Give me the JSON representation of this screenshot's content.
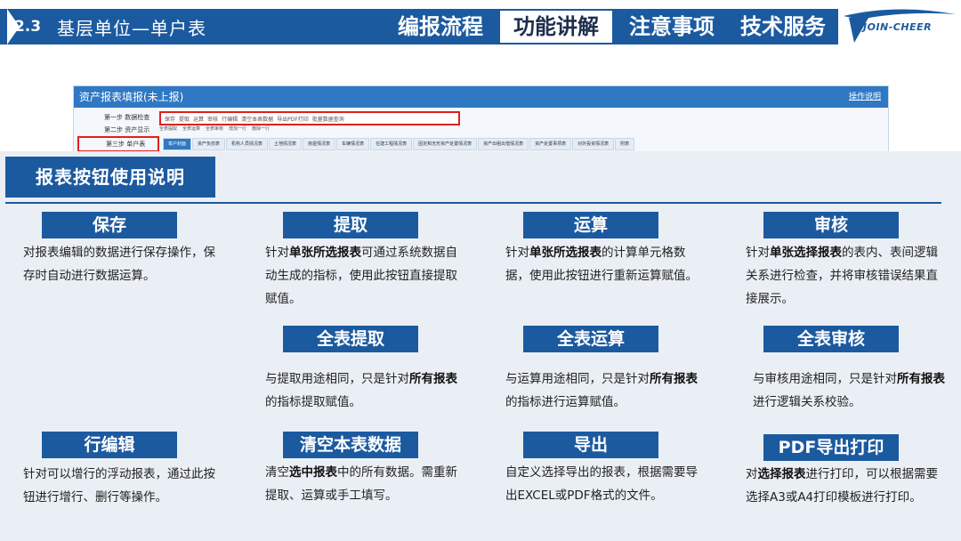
{
  "header": {
    "section_number": "2.3",
    "section_title": "基层单位—单户表",
    "tabs": [
      {
        "label": "编报流程",
        "active": false
      },
      {
        "label": "功能讲解",
        "active": true
      },
      {
        "label": "注意事项",
        "active": false
      },
      {
        "label": "技术服务",
        "active": false
      }
    ],
    "logo_text": "JOIN-CHEER"
  },
  "screenshot": {
    "title": "资产报表填报(未上报)",
    "help_link": "操作说明",
    "steps": [
      "第一步 数据检查",
      "第二步 资产显示",
      "第三步 单户表"
    ],
    "toolbar": [
      "保存",
      "提取",
      "运算",
      "审核",
      "行编辑",
      "清空本表数据",
      "导出PDF打印",
      "批量数据查询"
    ],
    "toolbar_sub": [
      "全表提取",
      "全表运算",
      "全表审核",
      "增加一行",
      "删除一行"
    ],
    "sheet_tabs": [
      "单户封面",
      "资产负债表",
      "机构人员情况表",
      "土地情况表",
      "房屋情况表",
      "车辆情况表",
      "在建工程情况表",
      "固定和无形资产处置情况表",
      "资产出租出借情况表",
      "资产处置事项表",
      "对外投资情况表",
      "附表"
    ]
  },
  "panel": {
    "title": "报表按钮使用说明",
    "items": [
      {
        "label": "保存",
        "desc": [
          {
            "t": "对报表编辑的数据进行保存操作，保存时自动进行数据运算。",
            "b": false
          }
        ]
      },
      {
        "label": "提取",
        "desc": [
          {
            "t": "针对",
            "b": false
          },
          {
            "t": "单张所选报表",
            "b": true
          },
          {
            "t": "可通过系统数据自动生成的指标，使用此按钮直接提取赋值。",
            "b": false
          }
        ]
      },
      {
        "label": "运算",
        "desc": [
          {
            "t": "针对",
            "b": false
          },
          {
            "t": "单张所选报表",
            "b": true
          },
          {
            "t": "的计算单元格数据，使用此按钮进行重新运算赋值。",
            "b": false
          }
        ]
      },
      {
        "label": "审核",
        "desc": [
          {
            "t": "针对",
            "b": false
          },
          {
            "t": "单张选择报表",
            "b": true
          },
          {
            "t": "的表内、表间逻辑关系进行检查，并将审核错误结果直接展示。",
            "b": false
          }
        ]
      },
      {
        "label": "全表提取",
        "desc": [
          {
            "t": "与提取用途相同，只是针对",
            "b": false
          },
          {
            "t": "所有报表",
            "b": true
          },
          {
            "t": "的指标提取赋值。",
            "b": false
          }
        ]
      },
      {
        "label": "全表运算",
        "desc": [
          {
            "t": "与运算用途相同，只是针对",
            "b": false
          },
          {
            "t": "所有报表",
            "b": true
          },
          {
            "t": "的指标进行运算赋值。",
            "b": false
          }
        ]
      },
      {
        "label": "全表审核",
        "desc": [
          {
            "t": "与审核用途相同，只是针对",
            "b": false
          },
          {
            "t": "所有报表",
            "b": true
          },
          {
            "t": "进行逻辑关系校验。",
            "b": false
          }
        ]
      },
      {
        "label": "行编辑",
        "desc": [
          {
            "t": "针对可以增行的浮动报表，通过此按钮进行增行、删行等操作。",
            "b": false
          }
        ]
      },
      {
        "label": "清空本表数据",
        "desc": [
          {
            "t": "清空",
            "b": false
          },
          {
            "t": "选中报表",
            "b": true
          },
          {
            "t": "中的所有数据。需重新提取、运算或手工填写。",
            "b": false
          }
        ]
      },
      {
        "label": "导出",
        "desc": [
          {
            "t": "自定义选择导出的报表，根据需要导出EXCEL或PDF格式的文件。",
            "b": false
          }
        ]
      },
      {
        "label": "PDF导出打印",
        "desc": [
          {
            "t": "对",
            "b": false
          },
          {
            "t": "选择报表",
            "b": true
          },
          {
            "t": "进行打印，可以根据需要选择A3或A4打印模板进行打印。",
            "b": false
          }
        ]
      }
    ]
  }
}
